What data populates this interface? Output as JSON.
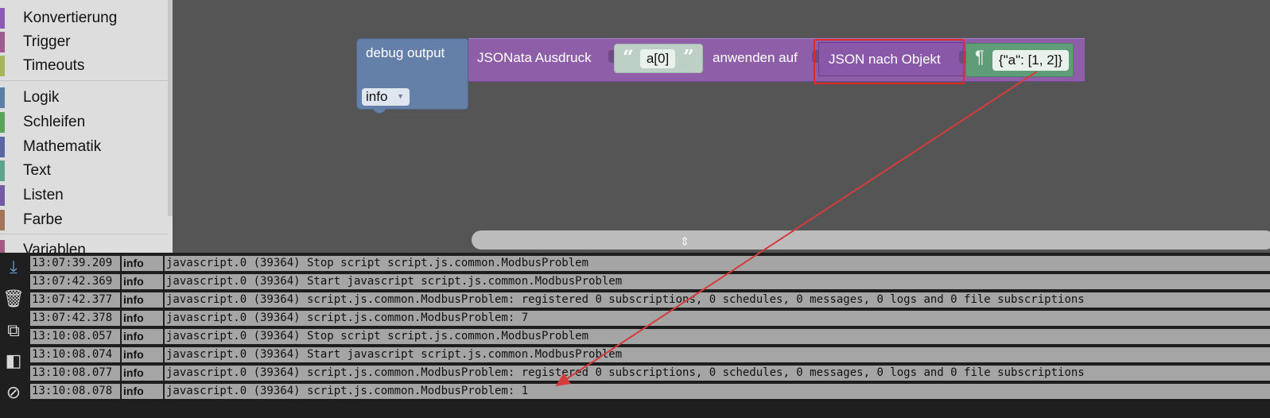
{
  "toolbox": {
    "categories": [
      {
        "label": "Konvertierung",
        "color": "#8a5ab4"
      },
      {
        "label": "Trigger",
        "color": "#a25a8c"
      },
      {
        "label": "Timeouts",
        "color": "#a5b55a"
      },
      {
        "label": "Logik",
        "color": "#5a80a5"
      },
      {
        "label": "Schleifen",
        "color": "#5ba55b"
      },
      {
        "label": "Mathematik",
        "color": "#5b67a5"
      },
      {
        "label": "Text",
        "color": "#5ba58c"
      },
      {
        "label": "Listen",
        "color": "#745ba5"
      },
      {
        "label": "Farbe",
        "color": "#a5745b"
      },
      {
        "label": "Variablen",
        "color": "#a55b80"
      }
    ]
  },
  "blocks": {
    "debug": {
      "title": "debug output",
      "level": "info"
    },
    "jsonata": {
      "label": "JSONata Ausdruck",
      "apply_label": "anwenden auf",
      "expression": "a[0]",
      "quote_open": "“",
      "quote_close": "”"
    },
    "json_to_object": {
      "label": "JSON nach Objekt"
    },
    "text": {
      "pilcrow": "¶",
      "value": "{\"a\": [1, 2]}"
    }
  },
  "log": {
    "rows": [
      {
        "time": "13:07:39.209",
        "severity": "info",
        "message": "javascript.0 (39364) Stop script script.js.common.ModbusProblem"
      },
      {
        "time": "13:07:42.369",
        "severity": "info",
        "message": "javascript.0 (39364) Start javascript script.js.common.ModbusProblem"
      },
      {
        "time": "13:07:42.377",
        "severity": "info",
        "message": "javascript.0 (39364) script.js.common.ModbusProblem: registered 0 subscriptions, 0 schedules, 0 messages, 0 logs and 0 file subscriptions"
      },
      {
        "time": "13:07:42.378",
        "severity": "info",
        "message": "javascript.0 (39364) script.js.common.ModbusProblem: 7"
      },
      {
        "time": "13:10:08.057",
        "severity": "info",
        "message": "javascript.0 (39364) Stop script script.js.common.ModbusProblem"
      },
      {
        "time": "13:10:08.074",
        "severity": "info",
        "message": "javascript.0 (39364) Start javascript script.js.common.ModbusProblem"
      },
      {
        "time": "13:10:08.077",
        "severity": "info",
        "message": "javascript.0 (39364) script.js.common.ModbusProblem: registered 0 subscriptions, 0 schedules, 0 messages, 0 logs and 0 file subscriptions"
      },
      {
        "time": "13:10:08.078",
        "severity": "info",
        "message": "javascript.0 (39364) script.js.common.ModbusProblem: 1"
      }
    ],
    "toolbar_icons": [
      "scroll-to-bottom-icon",
      "clear-log-icon",
      "copy-icon",
      "toggle-view-icon",
      "hide-icon"
    ]
  },
  "colors": {
    "highlight": "#e0282c",
    "arrow": "#d63b3b"
  }
}
